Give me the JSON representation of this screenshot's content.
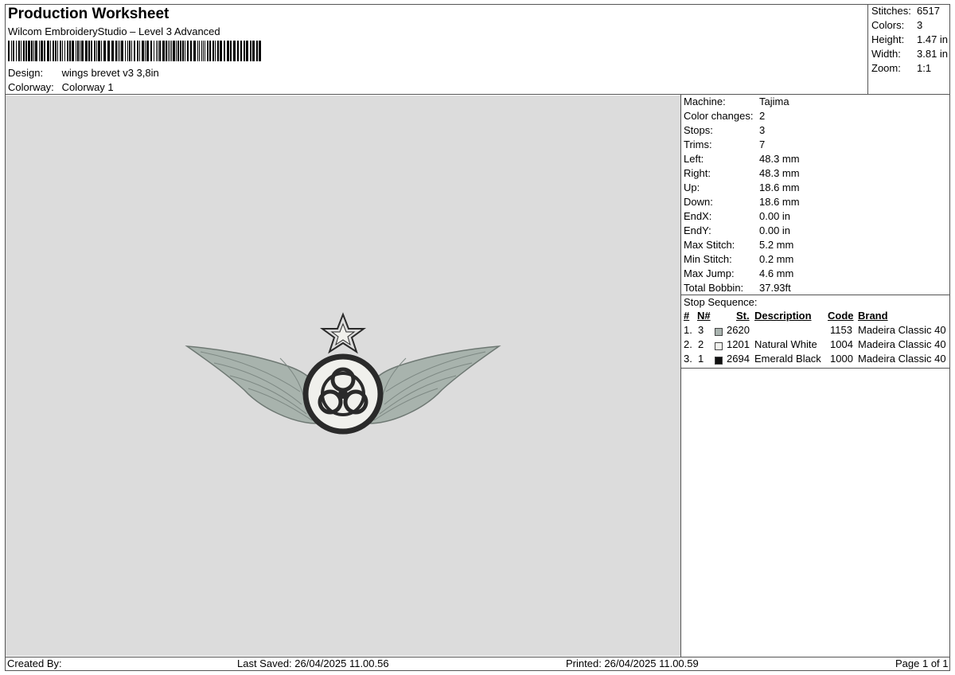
{
  "header": {
    "title": "Production Worksheet",
    "subtitle": "Wilcom EmbroideryStudio – Level 3 Advanced",
    "design_label": "Design:",
    "design_value": "wings brevet v3 3,8in",
    "colorway_label": "Colorway:",
    "colorway_value": "Colorway 1"
  },
  "summary": [
    {
      "label": "Stitches:",
      "value": "6517"
    },
    {
      "label": "Colors:",
      "value": "3"
    },
    {
      "label": "Height:",
      "value": "1.47 in"
    },
    {
      "label": "Width:",
      "value": "3.81 in"
    },
    {
      "label": "Zoom:",
      "value": "1:1"
    }
  ],
  "machine_info": [
    {
      "label": "Machine:",
      "value": "Tajima"
    },
    {
      "label": "Color changes:",
      "value": "2"
    },
    {
      "label": "Stops:",
      "value": "3"
    },
    {
      "label": "Trims:",
      "value": "7"
    },
    {
      "label": "Left:",
      "value": "48.3 mm"
    },
    {
      "label": "Right:",
      "value": "48.3 mm"
    },
    {
      "label": "Up:",
      "value": "18.6 mm"
    },
    {
      "label": "Down:",
      "value": "18.6 mm"
    },
    {
      "label": "EndX:",
      "value": "0.00 in"
    },
    {
      "label": "EndY:",
      "value": "0.00 in"
    },
    {
      "label": "Max Stitch:",
      "value": "5.2 mm"
    },
    {
      "label": "Min Stitch:",
      "value": "0.2 mm"
    },
    {
      "label": "Max Jump:",
      "value": "4.6 mm"
    },
    {
      "label": "Total Bobbin:",
      "value": "37.93ft"
    }
  ],
  "stop_sequence": {
    "title": "Stop Sequence:",
    "headers": {
      "num": "#",
      "n": "N#",
      "st": "St.",
      "description": "Description",
      "code": "Code",
      "brand": "Brand"
    },
    "rows": [
      {
        "num": "1.",
        "n": "3",
        "color": "#aab4b0",
        "st": "2620",
        "description": "",
        "code": "1153",
        "brand": "Madeira Classic 40"
      },
      {
        "num": "2.",
        "n": "2",
        "color": "#f2f2ee",
        "st": "1201",
        "description": "Natural White",
        "code": "1004",
        "brand": "Madeira Classic 40"
      },
      {
        "num": "3.",
        "n": "1",
        "color": "#111111",
        "st": "2694",
        "description": "Emerald Black",
        "code": "1000",
        "brand": "Madeira Classic 40"
      }
    ]
  },
  "footer": {
    "created_by": "Created By:",
    "last_saved": "Last Saved: 26/04/2025 11.00.56",
    "printed": "Printed: 26/04/2025 11.00.59",
    "page": "Page 1 of 1"
  },
  "design_colors": {
    "wing": "#a8b3ad",
    "white": "#f0f0ec",
    "black": "#2a2a2a",
    "background": "#dcdcdc"
  }
}
